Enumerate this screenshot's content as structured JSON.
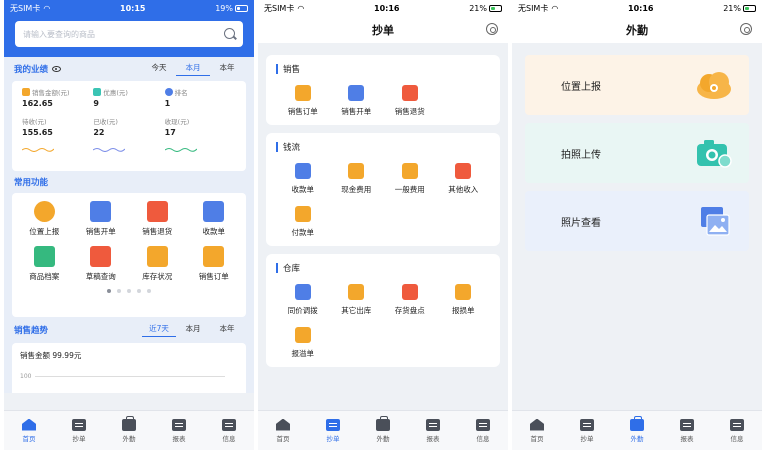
{
  "status": [
    {
      "carrier": "无SIM卡",
      "time": "10:15",
      "battery": "19%"
    },
    {
      "carrier": "无SIM卡",
      "time": "10:16",
      "battery": "21%"
    },
    {
      "carrier": "无SIM卡",
      "time": "10:16",
      "battery": "21%"
    }
  ],
  "home": {
    "search_placeholder": "请输入要查询的商品",
    "performance": {
      "title": "我的业绩",
      "tabs": [
        "今天",
        "本月",
        "本年"
      ],
      "active_tab": "本月",
      "metrics": [
        {
          "label": "销售金额(元)",
          "value": "162.65"
        },
        {
          "label": "优惠(元)",
          "value": "9"
        },
        {
          "label": "排名",
          "value": "1"
        },
        {
          "label": "待收(元)",
          "value": "155.65"
        },
        {
          "label": "已收(元)",
          "value": "22"
        },
        {
          "label": "收现(元)",
          "value": "17"
        }
      ]
    },
    "common": {
      "title": "常用功能",
      "items": [
        "位置上报",
        "销售开单",
        "销售退货",
        "收款单",
        "商品档案",
        "草稿查询",
        "库存状况",
        "销售订单"
      ]
    },
    "trend": {
      "title": "销售趋势",
      "tabs": [
        "近7天",
        "本月",
        "本年"
      ],
      "active_tab": "近7天",
      "amount_label": "销售金额 99.99元",
      "y_tick": "100"
    }
  },
  "copy": {
    "title": "抄单",
    "groups": [
      {
        "title": "销售",
        "items": [
          "销售订单",
          "销售开单",
          "销售退货"
        ]
      },
      {
        "title": "钱流",
        "items": [
          "收款单",
          "现金费用",
          "一般费用",
          "其他收入",
          "付款单"
        ]
      },
      {
        "title": "仓库",
        "items": [
          "同价调拨",
          "其它出库",
          "存货盘点",
          "报损单",
          "报溢单"
        ]
      }
    ]
  },
  "field": {
    "title": "外勤",
    "cards": [
      "位置上报",
      "拍照上传",
      "照片查看"
    ]
  },
  "nav": [
    "首页",
    "抄单",
    "外勤",
    "报表",
    "信息"
  ],
  "colors": {
    "accent": "#2f6ee8",
    "card1": "#fdf3e7",
    "card2": "#e9f6f4",
    "card3": "#eaf0fb"
  }
}
